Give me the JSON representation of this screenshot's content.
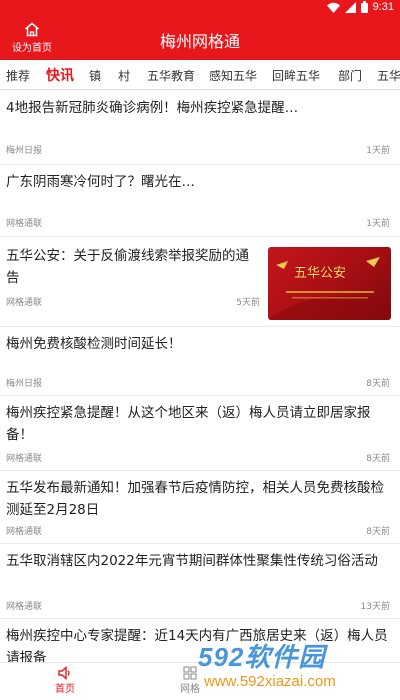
{
  "status_bar": {
    "time": "9:31"
  },
  "header": {
    "home_label": "设为首页",
    "title": "梅州网格通"
  },
  "tabs": [
    "推荐",
    "快讯",
    "镇",
    "村",
    "五华教育",
    "感知五华",
    "回眸五华",
    "部门",
    "五华"
  ],
  "active_tab": "快讯",
  "news": [
    {
      "title": "4地报告新冠肺炎确诊病例！梅州疾控紧急提醒…",
      "source": "梅州日报",
      "time": "1天前"
    },
    {
      "title": "广东阴雨寒冷何时了？曙光在…",
      "source": "网格通联",
      "time": "1天前"
    },
    {
      "title": "五华公安：关于反偷渡线索举报奖励的通告",
      "source": "网格通联",
      "time": "5天前",
      "has_thumbnail": true,
      "thumbnail_text": "五华公安"
    },
    {
      "title": "梅州免费核酸检测时间延长！",
      "source": "梅州日报",
      "time": "8天前"
    },
    {
      "title": "梅州疾控紧急提醒！从这个地区来（返）梅人员请立即居家报备！",
      "source": "网格通联",
      "time": "8天前"
    },
    {
      "title": "五华发布最新通知！加强春节后疫情防控，相关人员免费核酸检测延至2月28日",
      "source": "网格通联",
      "time": "8天前"
    },
    {
      "title": "五华取消辖区内2022年元宵节期间群体性聚集性传统习俗活动",
      "source": "网格通联",
      "time": "13天前"
    },
    {
      "title": "梅州疾控中心专家提醒：近14天内有广西旅居史来（返）梅人员请报备",
      "source": "",
      "time": ""
    }
  ],
  "bottom_nav": {
    "home_label": "首页",
    "grid_label": "网格"
  },
  "watermark": {
    "brand": "592软件园",
    "url": "www.592xiazai.com"
  },
  "colors": {
    "brand_red": "#e8171c",
    "meta_gray": "#8a8a8a"
  }
}
